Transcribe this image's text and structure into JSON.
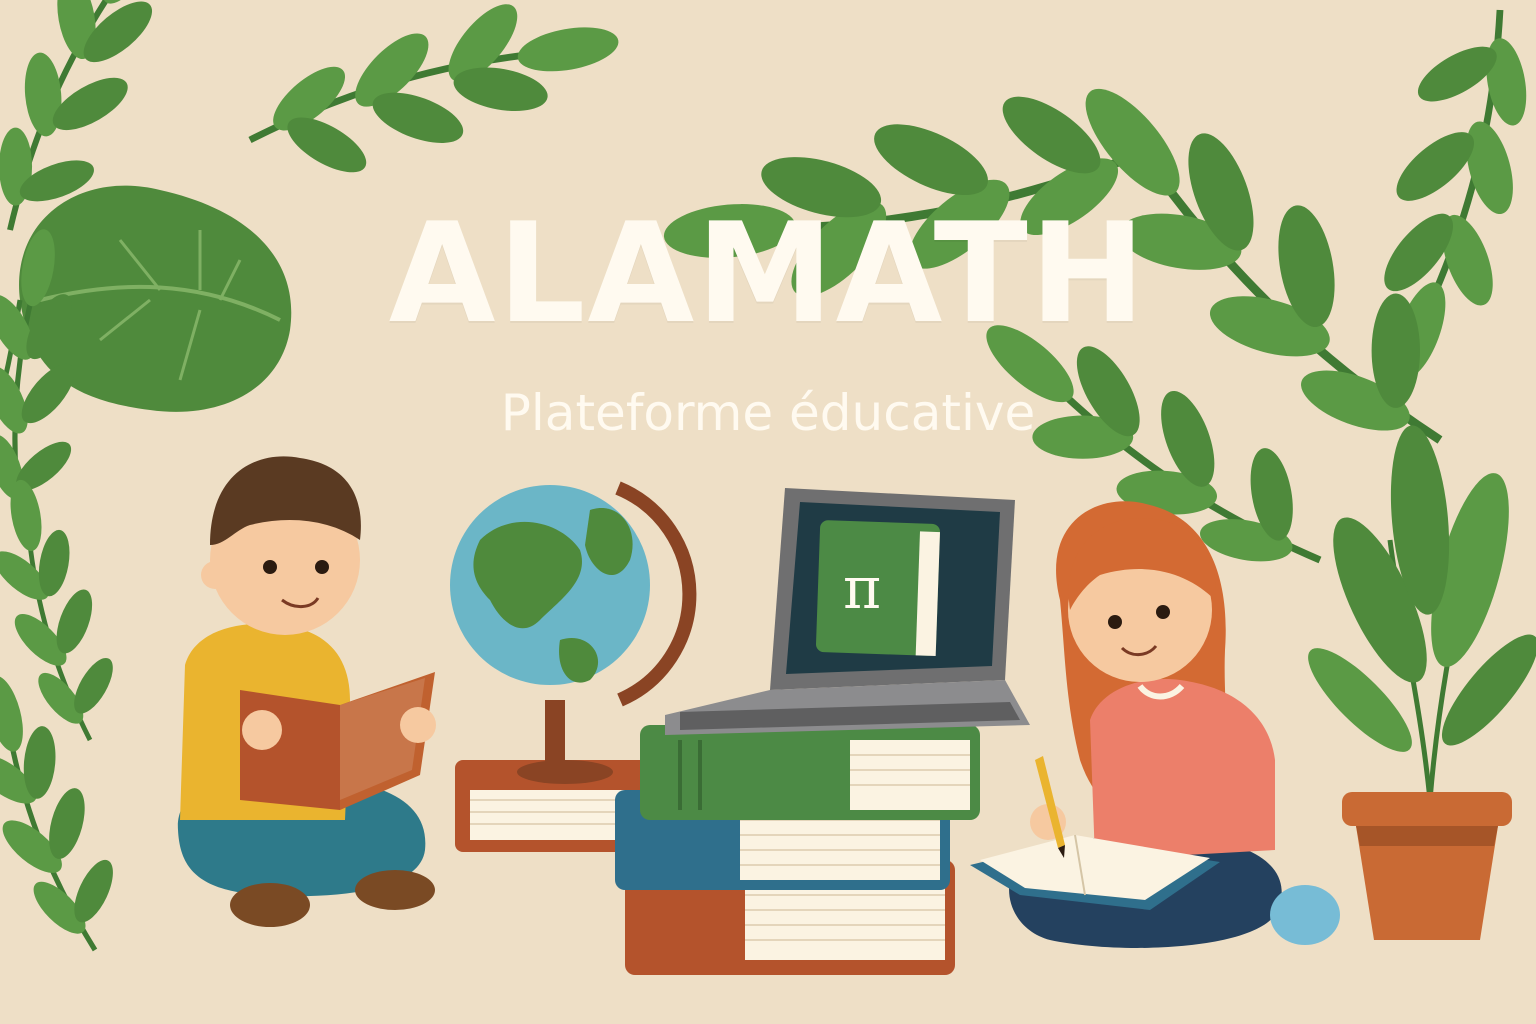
{
  "brand": {
    "title": "ALAMATH",
    "subtitle": "Plateforme éducative"
  },
  "screen_symbol": "π",
  "icons": [
    "globe-icon",
    "laptop-icon",
    "book-stack-icon",
    "potted-plant-icon",
    "pencil-icon"
  ],
  "colors": {
    "background": "#eedfc6",
    "title_text": "#fffaf0",
    "leaf_green": "#4f8a3c",
    "book_green": "#4c8a45",
    "book_blue": "#2f6f8c",
    "book_red": "#b4532c",
    "pot_orange": "#c96a34"
  }
}
